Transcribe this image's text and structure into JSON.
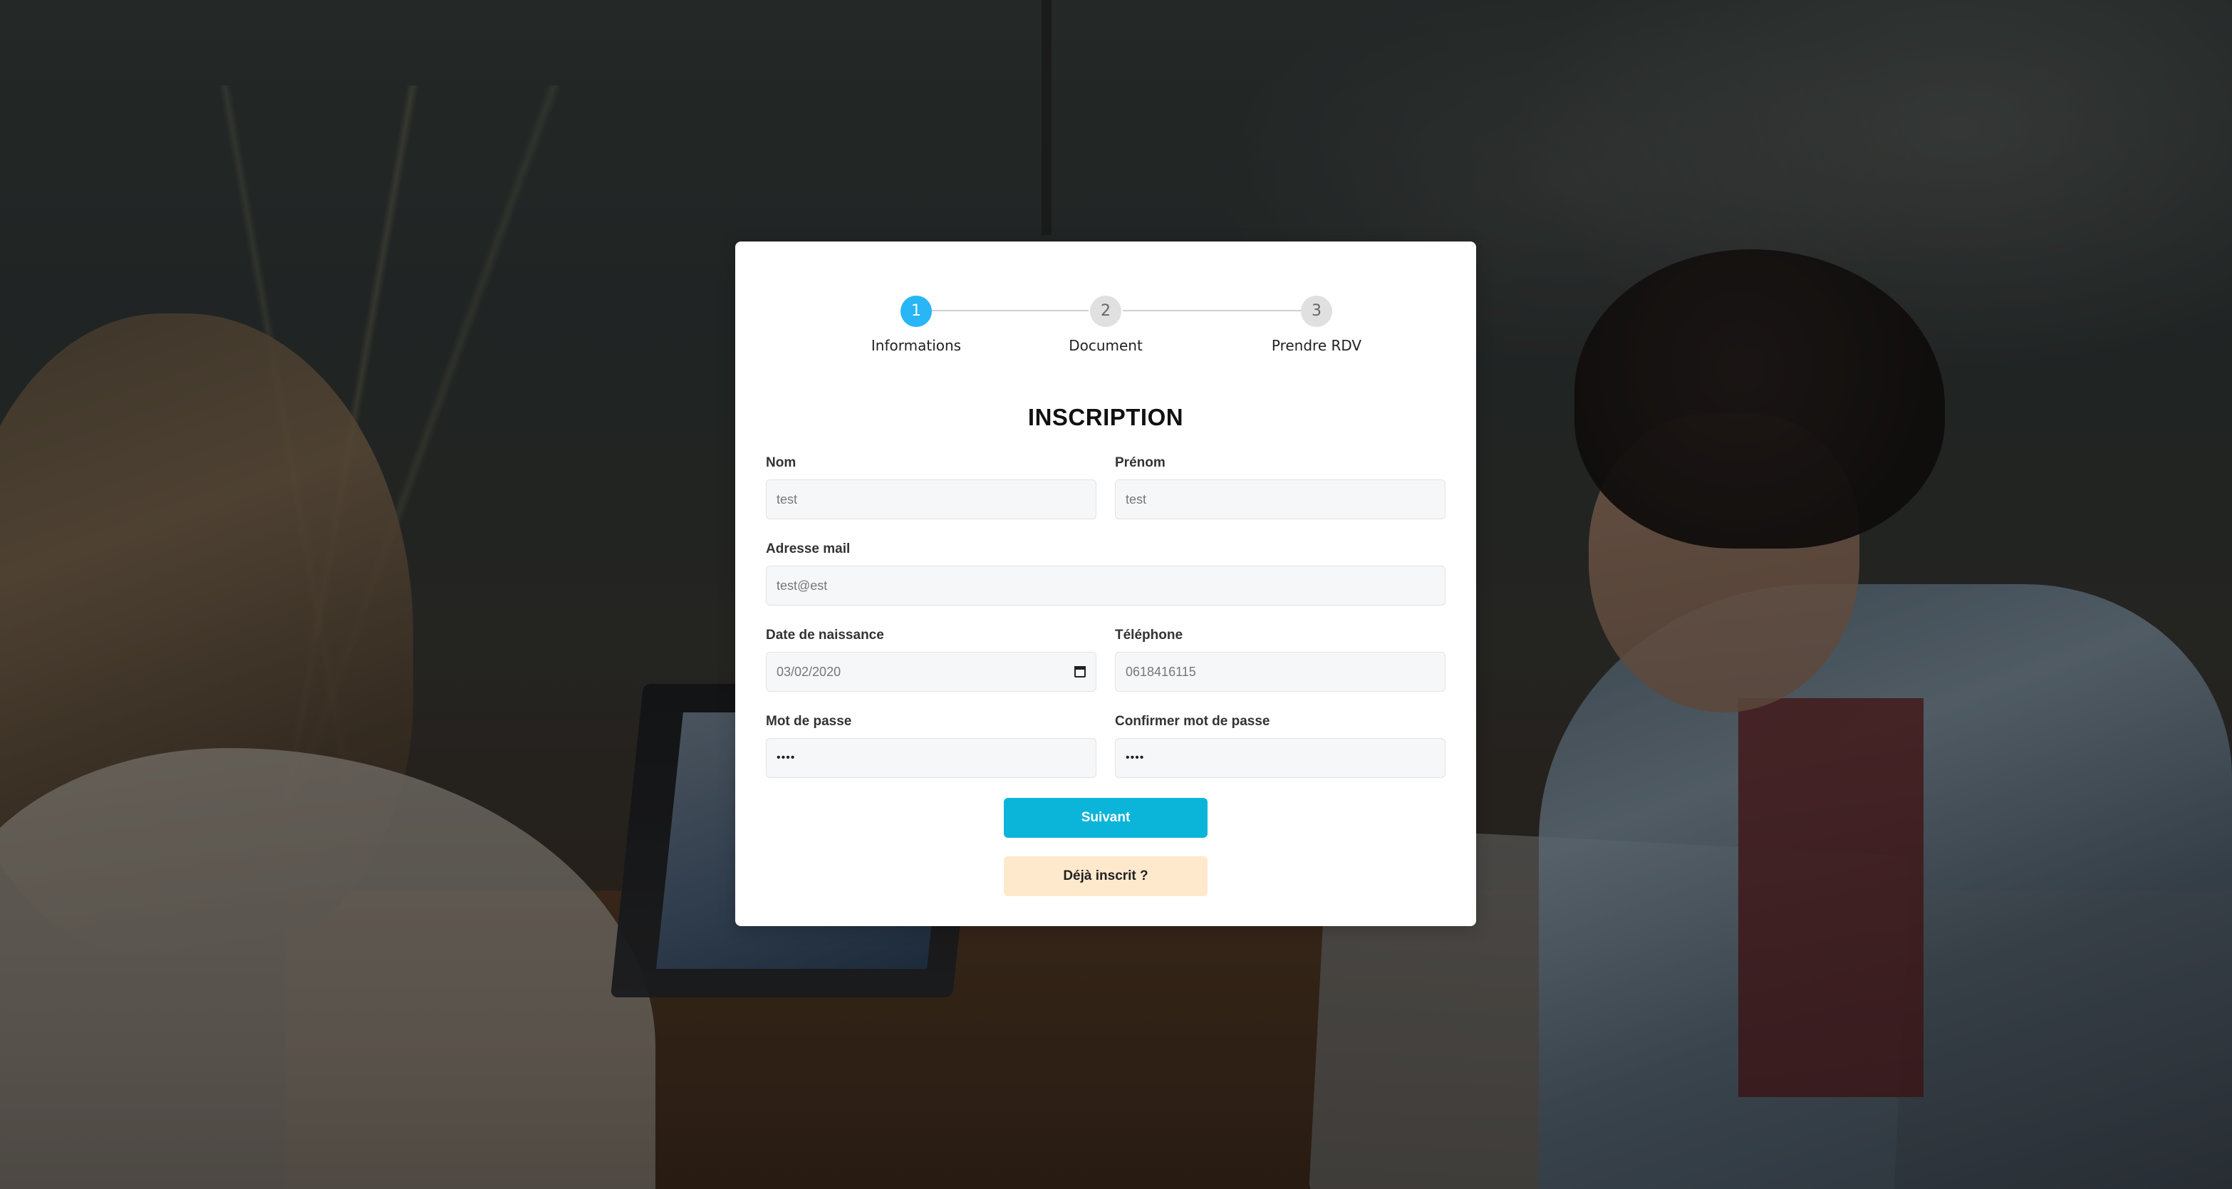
{
  "stepper": {
    "steps": [
      {
        "number": "1",
        "label": "Informations",
        "active": true
      },
      {
        "number": "2",
        "label": "Document",
        "active": false
      },
      {
        "number": "3",
        "label": "Prendre RDV",
        "active": false
      }
    ]
  },
  "form": {
    "title": "INSCRIPTION",
    "nom": {
      "label": "Nom",
      "value": "test"
    },
    "prenom": {
      "label": "Prénom",
      "value": "test"
    },
    "email": {
      "label": "Adresse mail",
      "value": "test@est"
    },
    "birthdate": {
      "label": "Date de naissance",
      "value": "03/02/2020"
    },
    "phone": {
      "label": "Téléphone",
      "value": "0618416115"
    },
    "password": {
      "label": "Mot de passe",
      "value": "••••"
    },
    "confirm_password": {
      "label": "Confirmer mot de passe",
      "value": "••••"
    }
  },
  "buttons": {
    "next": "Suivant",
    "already_registered": "Déjà inscrit ?"
  },
  "colors": {
    "accent": "#0bb5da",
    "step_active": "#29b6f6",
    "secondary_button": "#ffe9cc"
  },
  "icons": {
    "calendar": "calendar-icon"
  }
}
